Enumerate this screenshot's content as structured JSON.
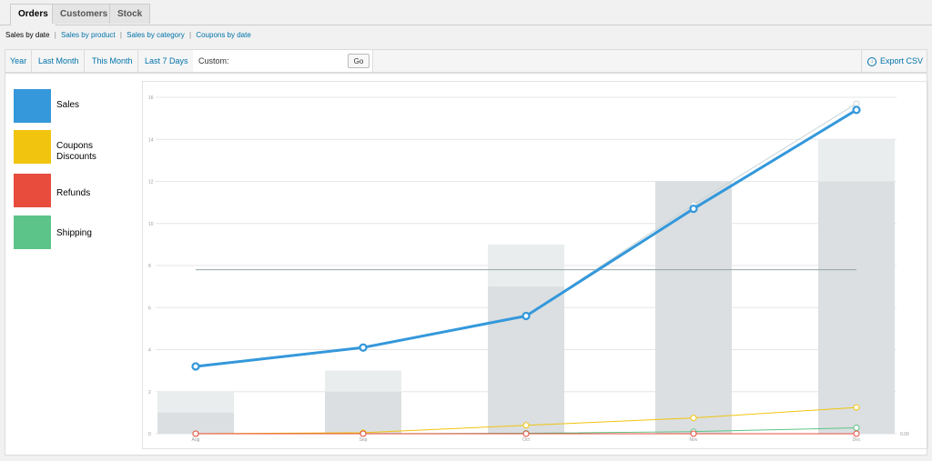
{
  "tabs": [
    {
      "label": "Orders",
      "active": true
    },
    {
      "label": "Customers",
      "active": false
    },
    {
      "label": "Stock",
      "active": false
    }
  ],
  "report_links": {
    "current": "Sales by date",
    "links": [
      "Sales by product",
      "Sales by category",
      "Coupons by date"
    ],
    "separator": "|"
  },
  "ranges": [
    "Year",
    "Last Month",
    "This Month",
    "Last 7 Days"
  ],
  "custom": {
    "label": "Custom:",
    "go": "Go"
  },
  "export": {
    "label": "Export CSV",
    "icon": "download-icon"
  },
  "legend": [
    {
      "label": "Sales",
      "color": "#3498db"
    },
    {
      "label": "Coupons Discounts",
      "color": "#f1c40f"
    },
    {
      "label": "Refunds",
      "color": "#e74c3c"
    },
    {
      "label": "Shipping",
      "color": "#5cc488"
    }
  ],
  "chart_data": {
    "type": "bar",
    "categories": [
      "Aug",
      "Sep",
      "Oct",
      "Nov",
      "Dec"
    ],
    "ylim": [
      0,
      16
    ],
    "yticks": [
      "0",
      "2",
      "4",
      "6",
      "8",
      "10",
      "12",
      "14",
      "16"
    ],
    "right_axis_label": "0.00",
    "bars_total": [
      2,
      3,
      9,
      12,
      14
    ],
    "bars_inner": [
      1,
      2,
      7,
      12,
      12
    ],
    "average_line": 7.8,
    "series": [
      {
        "name": "Sales",
        "color": "#3498db",
        "values": [
          3.2,
          4.1,
          5.6,
          10.7,
          15.4
        ]
      },
      {
        "name": "Coupons Discounts",
        "color": "#f1c40f",
        "values": [
          0,
          0.05,
          0.4,
          0.75,
          1.25
        ]
      },
      {
        "name": "Shipping",
        "color": "#5cc488",
        "values": [
          0,
          0,
          0.02,
          0.1,
          0.28
        ]
      },
      {
        "name": "Refunds",
        "color": "#e74c3c",
        "values": [
          0,
          0,
          0,
          0,
          0
        ]
      }
    ],
    "ghost_series": {
      "color": "#c8d3d6",
      "values": [
        3.2,
        4.1,
        5.6,
        10.9,
        15.7
      ]
    }
  }
}
